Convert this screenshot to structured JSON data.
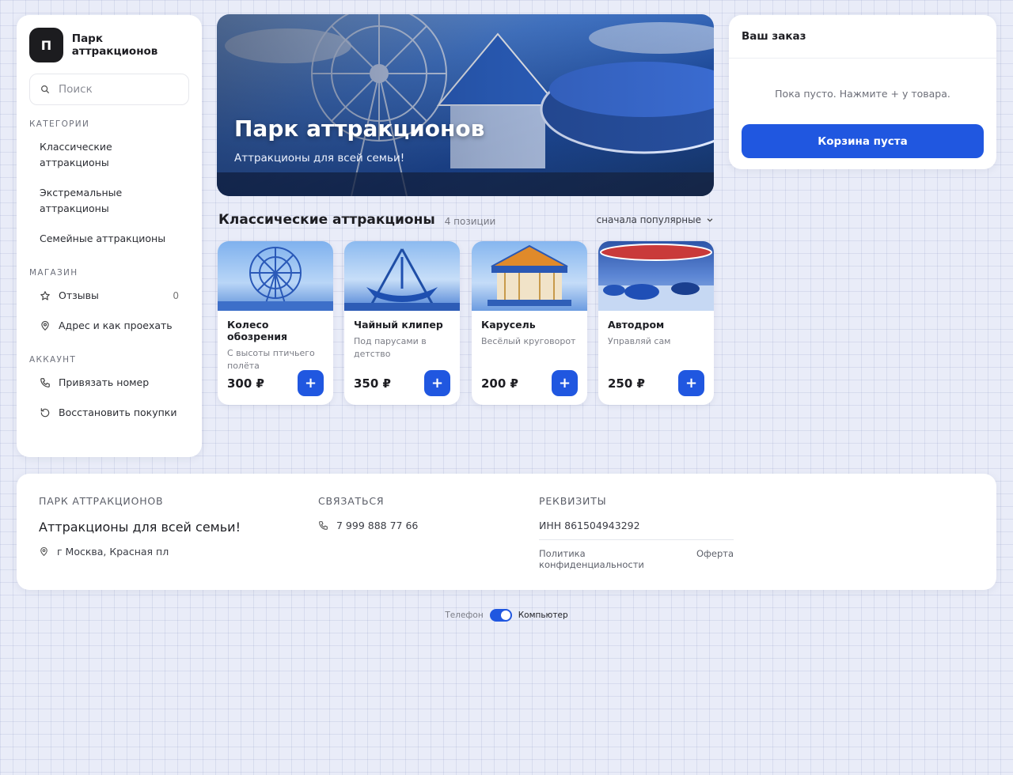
{
  "brand": {
    "logo_letter": "П",
    "name": "Парк аттракционов"
  },
  "search": {
    "placeholder": "Поиск"
  },
  "sidebar": {
    "categories_label": "КАТЕГОРИИ",
    "categories": [
      "Классические аттракционы",
      "Экстремальные аттракционы",
      "Семейные аттракционы"
    ],
    "shop_label": "МАГАЗИН",
    "reviews_label": "Отзывы",
    "reviews_count": "0",
    "address_label": "Адрес и как проехать",
    "account_label": "АККАУНТ",
    "link_phone_label": "Привязать номер",
    "restore_label": "Восстановить покупки"
  },
  "hero": {
    "title": "Парк аттракционов",
    "subtitle": "Аттракционы для всей семьи!"
  },
  "section": {
    "title": "Классические аттракционы",
    "count": "4 позиции",
    "sort": "сначала популярные"
  },
  "products": [
    {
      "name": "Колесо обозрения",
      "desc": "С высоты птичьего полёта",
      "price": "300 ₽",
      "add": "+"
    },
    {
      "name": "Чайный клипер",
      "desc": "Под парусами в детство",
      "price": "350 ₽",
      "add": "+"
    },
    {
      "name": "Карусель",
      "desc": "Весёлый круговорот",
      "price": "200 ₽",
      "add": "+"
    },
    {
      "name": "Автодром",
      "desc": "Управляй сам",
      "price": "250 ₽",
      "add": "+"
    }
  ],
  "order": {
    "title": "Ваш заказ",
    "empty": "Пока пусто. Нажмите + у товара.",
    "button": "Корзина пуста"
  },
  "footer": {
    "brand_head": "ПАРК АТТРАКЦИОНОВ",
    "tagline": "Аттракционы для всей семьи!",
    "address": "г Москва, Красная пл",
    "contact_head": "СВЯЗАТЬСЯ",
    "phone": "7 999 888 77 66",
    "details_head": "РЕКВИЗИТЫ",
    "inn": "ИНН 861504943292",
    "privacy": "Политика конфиденциальности",
    "offer": "Оферта"
  },
  "view_toggle": {
    "phone": "Телефон",
    "computer": "Компьютер",
    "selected": "Компьютер"
  },
  "colors": {
    "accent": "#2057e0",
    "logo_bg": "#1c1c1f"
  }
}
